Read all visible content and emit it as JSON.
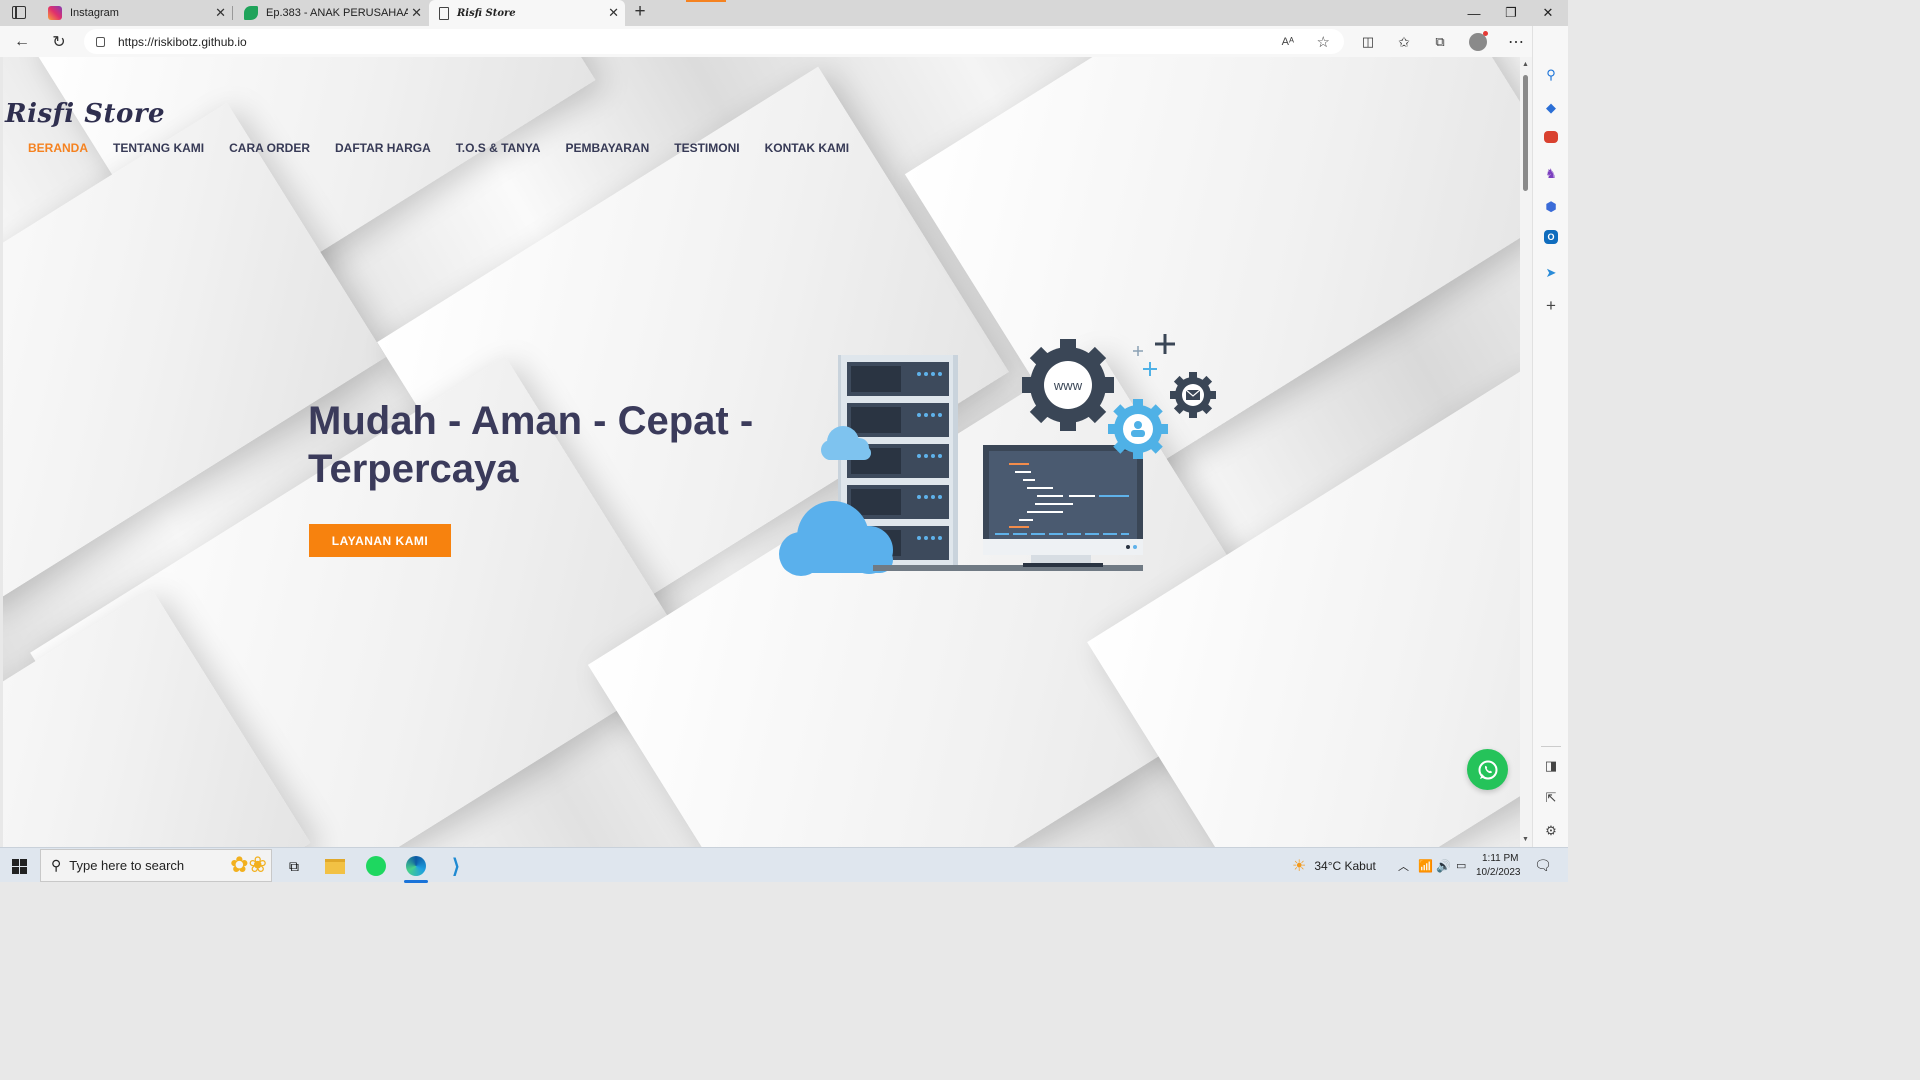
{
  "browser": {
    "tabs": [
      {
        "title": "Instagram",
        "icon": "instagram-icon",
        "active": false
      },
      {
        "title": "Ep.383 - ANAK PERUSAHAAN KE",
        "icon": "green-leaf-icon",
        "active": false
      },
      {
        "title": "Risfi Store",
        "icon": "page-icon",
        "active": true
      }
    ],
    "url": "https://riskibotz.github.io"
  },
  "site": {
    "brand": "Risfi Store",
    "menu": [
      "BERANDA",
      "TENTANG KAMI",
      "CARA ORDER",
      "DAFTAR HARGA",
      "T.O.S & TANYA",
      "PEMBAYARAN",
      "TESTIMONI",
      "KONTAK KAMI"
    ],
    "active_menu": "BERANDA",
    "headline": "Mudah - Aman - Cepat - Terpercaya",
    "cta": "LAYANAN KAMI",
    "illustration_text": "www",
    "accent_color": "#f7820e",
    "heading_color": "#3b3b5b"
  },
  "taskbar": {
    "search_placeholder": "Type here to search",
    "weather": "34°C  Kabut",
    "time": "1:11 PM",
    "date": "10/2/2023"
  }
}
